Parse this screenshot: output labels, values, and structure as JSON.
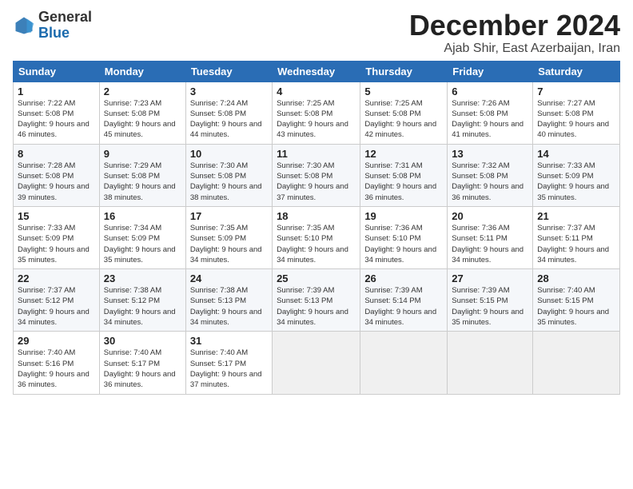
{
  "header": {
    "logo_general": "General",
    "logo_blue": "Blue",
    "month_title": "December 2024",
    "subtitle": "Ajab Shir, East Azerbaijan, Iran"
  },
  "weekdays": [
    "Sunday",
    "Monday",
    "Tuesday",
    "Wednesday",
    "Thursday",
    "Friday",
    "Saturday"
  ],
  "weeks": [
    [
      {
        "day": "1",
        "sunrise": "Sunrise: 7:22 AM",
        "sunset": "Sunset: 5:08 PM",
        "daylight": "Daylight: 9 hours and 46 minutes."
      },
      {
        "day": "2",
        "sunrise": "Sunrise: 7:23 AM",
        "sunset": "Sunset: 5:08 PM",
        "daylight": "Daylight: 9 hours and 45 minutes."
      },
      {
        "day": "3",
        "sunrise": "Sunrise: 7:24 AM",
        "sunset": "Sunset: 5:08 PM",
        "daylight": "Daylight: 9 hours and 44 minutes."
      },
      {
        "day": "4",
        "sunrise": "Sunrise: 7:25 AM",
        "sunset": "Sunset: 5:08 PM",
        "daylight": "Daylight: 9 hours and 43 minutes."
      },
      {
        "day": "5",
        "sunrise": "Sunrise: 7:25 AM",
        "sunset": "Sunset: 5:08 PM",
        "daylight": "Daylight: 9 hours and 42 minutes."
      },
      {
        "day": "6",
        "sunrise": "Sunrise: 7:26 AM",
        "sunset": "Sunset: 5:08 PM",
        "daylight": "Daylight: 9 hours and 41 minutes."
      },
      {
        "day": "7",
        "sunrise": "Sunrise: 7:27 AM",
        "sunset": "Sunset: 5:08 PM",
        "daylight": "Daylight: 9 hours and 40 minutes."
      }
    ],
    [
      {
        "day": "8",
        "sunrise": "Sunrise: 7:28 AM",
        "sunset": "Sunset: 5:08 PM",
        "daylight": "Daylight: 9 hours and 39 minutes."
      },
      {
        "day": "9",
        "sunrise": "Sunrise: 7:29 AM",
        "sunset": "Sunset: 5:08 PM",
        "daylight": "Daylight: 9 hours and 38 minutes."
      },
      {
        "day": "10",
        "sunrise": "Sunrise: 7:30 AM",
        "sunset": "Sunset: 5:08 PM",
        "daylight": "Daylight: 9 hours and 38 minutes."
      },
      {
        "day": "11",
        "sunrise": "Sunrise: 7:30 AM",
        "sunset": "Sunset: 5:08 PM",
        "daylight": "Daylight: 9 hours and 37 minutes."
      },
      {
        "day": "12",
        "sunrise": "Sunrise: 7:31 AM",
        "sunset": "Sunset: 5:08 PM",
        "daylight": "Daylight: 9 hours and 36 minutes."
      },
      {
        "day": "13",
        "sunrise": "Sunrise: 7:32 AM",
        "sunset": "Sunset: 5:08 PM",
        "daylight": "Daylight: 9 hours and 36 minutes."
      },
      {
        "day": "14",
        "sunrise": "Sunrise: 7:33 AM",
        "sunset": "Sunset: 5:09 PM",
        "daylight": "Daylight: 9 hours and 35 minutes."
      }
    ],
    [
      {
        "day": "15",
        "sunrise": "Sunrise: 7:33 AM",
        "sunset": "Sunset: 5:09 PM",
        "daylight": "Daylight: 9 hours and 35 minutes."
      },
      {
        "day": "16",
        "sunrise": "Sunrise: 7:34 AM",
        "sunset": "Sunset: 5:09 PM",
        "daylight": "Daylight: 9 hours and 35 minutes."
      },
      {
        "day": "17",
        "sunrise": "Sunrise: 7:35 AM",
        "sunset": "Sunset: 5:09 PM",
        "daylight": "Daylight: 9 hours and 34 minutes."
      },
      {
        "day": "18",
        "sunrise": "Sunrise: 7:35 AM",
        "sunset": "Sunset: 5:10 PM",
        "daylight": "Daylight: 9 hours and 34 minutes."
      },
      {
        "day": "19",
        "sunrise": "Sunrise: 7:36 AM",
        "sunset": "Sunset: 5:10 PM",
        "daylight": "Daylight: 9 hours and 34 minutes."
      },
      {
        "day": "20",
        "sunrise": "Sunrise: 7:36 AM",
        "sunset": "Sunset: 5:11 PM",
        "daylight": "Daylight: 9 hours and 34 minutes."
      },
      {
        "day": "21",
        "sunrise": "Sunrise: 7:37 AM",
        "sunset": "Sunset: 5:11 PM",
        "daylight": "Daylight: 9 hours and 34 minutes."
      }
    ],
    [
      {
        "day": "22",
        "sunrise": "Sunrise: 7:37 AM",
        "sunset": "Sunset: 5:12 PM",
        "daylight": "Daylight: 9 hours and 34 minutes."
      },
      {
        "day": "23",
        "sunrise": "Sunrise: 7:38 AM",
        "sunset": "Sunset: 5:12 PM",
        "daylight": "Daylight: 9 hours and 34 minutes."
      },
      {
        "day": "24",
        "sunrise": "Sunrise: 7:38 AM",
        "sunset": "Sunset: 5:13 PM",
        "daylight": "Daylight: 9 hours and 34 minutes."
      },
      {
        "day": "25",
        "sunrise": "Sunrise: 7:39 AM",
        "sunset": "Sunset: 5:13 PM",
        "daylight": "Daylight: 9 hours and 34 minutes."
      },
      {
        "day": "26",
        "sunrise": "Sunrise: 7:39 AM",
        "sunset": "Sunset: 5:14 PM",
        "daylight": "Daylight: 9 hours and 34 minutes."
      },
      {
        "day": "27",
        "sunrise": "Sunrise: 7:39 AM",
        "sunset": "Sunset: 5:15 PM",
        "daylight": "Daylight: 9 hours and 35 minutes."
      },
      {
        "day": "28",
        "sunrise": "Sunrise: 7:40 AM",
        "sunset": "Sunset: 5:15 PM",
        "daylight": "Daylight: 9 hours and 35 minutes."
      }
    ],
    [
      {
        "day": "29",
        "sunrise": "Sunrise: 7:40 AM",
        "sunset": "Sunset: 5:16 PM",
        "daylight": "Daylight: 9 hours and 36 minutes."
      },
      {
        "day": "30",
        "sunrise": "Sunrise: 7:40 AM",
        "sunset": "Sunset: 5:17 PM",
        "daylight": "Daylight: 9 hours and 36 minutes."
      },
      {
        "day": "31",
        "sunrise": "Sunrise: 7:40 AM",
        "sunset": "Sunset: 5:17 PM",
        "daylight": "Daylight: 9 hours and 37 minutes."
      },
      null,
      null,
      null,
      null
    ]
  ]
}
